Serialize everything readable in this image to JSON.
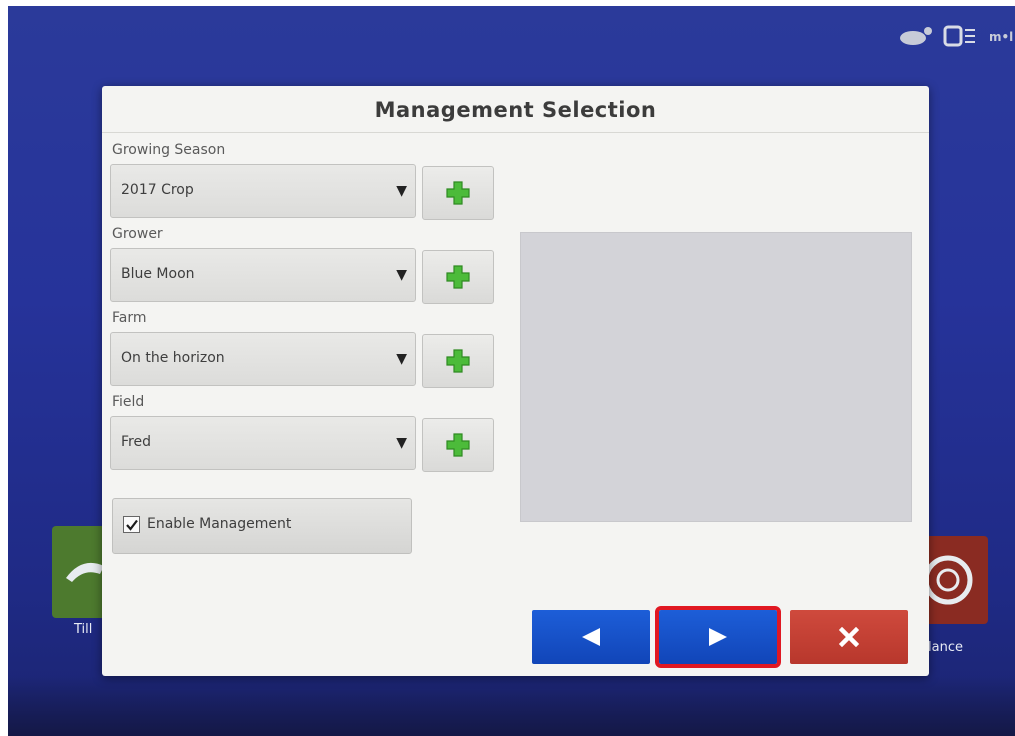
{
  "dialog": {
    "title": "Management Selection"
  },
  "fields": [
    {
      "label": "Growing Season",
      "value": "2017 Crop"
    },
    {
      "label": "Grower",
      "value": "Blue Moon"
    },
    {
      "label": "Farm",
      "value": "On the horizon"
    },
    {
      "label": "Field",
      "value": "Fred"
    }
  ],
  "enable_management": {
    "label": "Enable Management",
    "checked": true
  },
  "background_tiles": {
    "left_label": "Till",
    "right_label": "lance"
  },
  "icons": {
    "add": "plus-icon",
    "dropdown": "dropdown-arrow-icon",
    "back": "back-arrow-icon",
    "next": "next-arrow-icon",
    "cancel": "close-icon"
  },
  "colors": {
    "screen_bg": "#26339a",
    "dialog_bg": "#f4f4f2",
    "nav_blue": "#1652c8",
    "cancel_red": "#c23f33",
    "highlight_red": "#e01822",
    "plus_green": "#4cbb3a"
  }
}
